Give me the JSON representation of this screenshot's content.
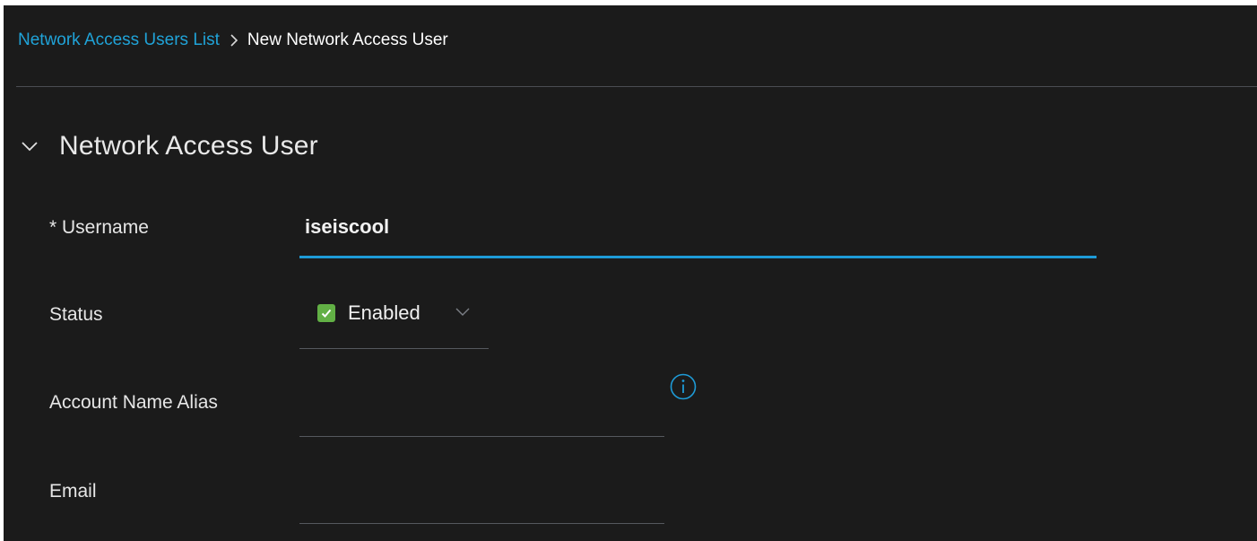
{
  "breadcrumb": {
    "parent_label": "Network Access Users List",
    "separator": ">",
    "current_label": "New Network Access User"
  },
  "section": {
    "title": "Network Access User",
    "expanded": true
  },
  "form": {
    "username": {
      "label": "* Username",
      "value": "iseiscool"
    },
    "status": {
      "label": "Status",
      "value": "Enabled",
      "checked": true
    },
    "account_name_alias": {
      "label": "Account Name Alias",
      "value": ""
    },
    "email": {
      "label": "Email",
      "value": ""
    }
  },
  "icons": {
    "section_toggle": "chevron-down-icon",
    "breadcrumb_separator": "chevron-right-icon",
    "status_check": "check-icon",
    "status_dropdown": "chevron-down-icon",
    "alias_info": "info-icon"
  },
  "colors": {
    "background": "#1b1b1b",
    "link": "#20a3d8",
    "focus_underline": "#1e9bd7",
    "enabled_green": "#62b045"
  }
}
